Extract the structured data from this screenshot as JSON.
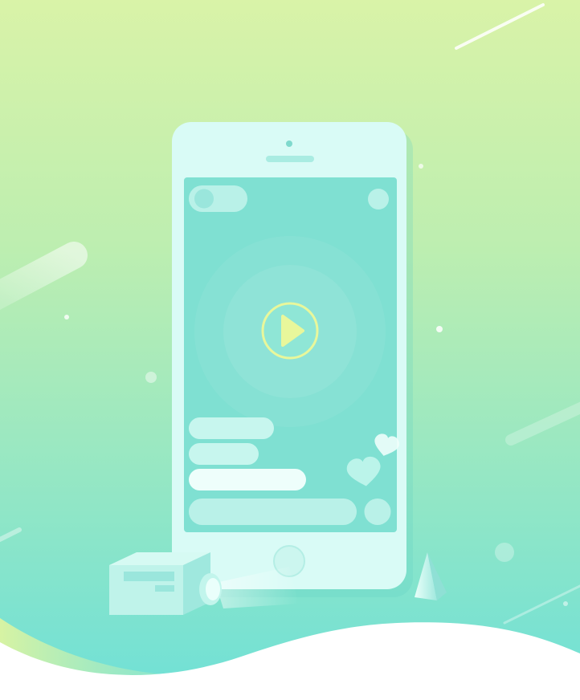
{
  "illustration": {
    "subject": "live-video-streaming-phone",
    "colors": {
      "background_top": "#d9f3a8",
      "background_bottom": "#6fe0d7",
      "phone_body": "#d9fbf6",
      "phone_screen": "#7fe0d2",
      "chat_bubble": "#c7f6ee",
      "chat_bubble_active": "#eefefb",
      "play_ring": "#e8f79b",
      "wave": "#ffffff"
    },
    "phone": {
      "icons": [
        "speaker-icon",
        "home-button-icon",
        "play-icon",
        "heart-icon",
        "camera-icon"
      ]
    },
    "live_screen": {
      "play_button": {
        "icon": "play-icon"
      },
      "chat_messages": [
        {
          "style": "bubble"
        },
        {
          "style": "bubble"
        },
        {
          "style": "bubble-active"
        }
      ],
      "reactions": {
        "icon": "heart-icon",
        "count_shown": 2
      }
    },
    "camera": {
      "icon": "camera-icon"
    }
  }
}
